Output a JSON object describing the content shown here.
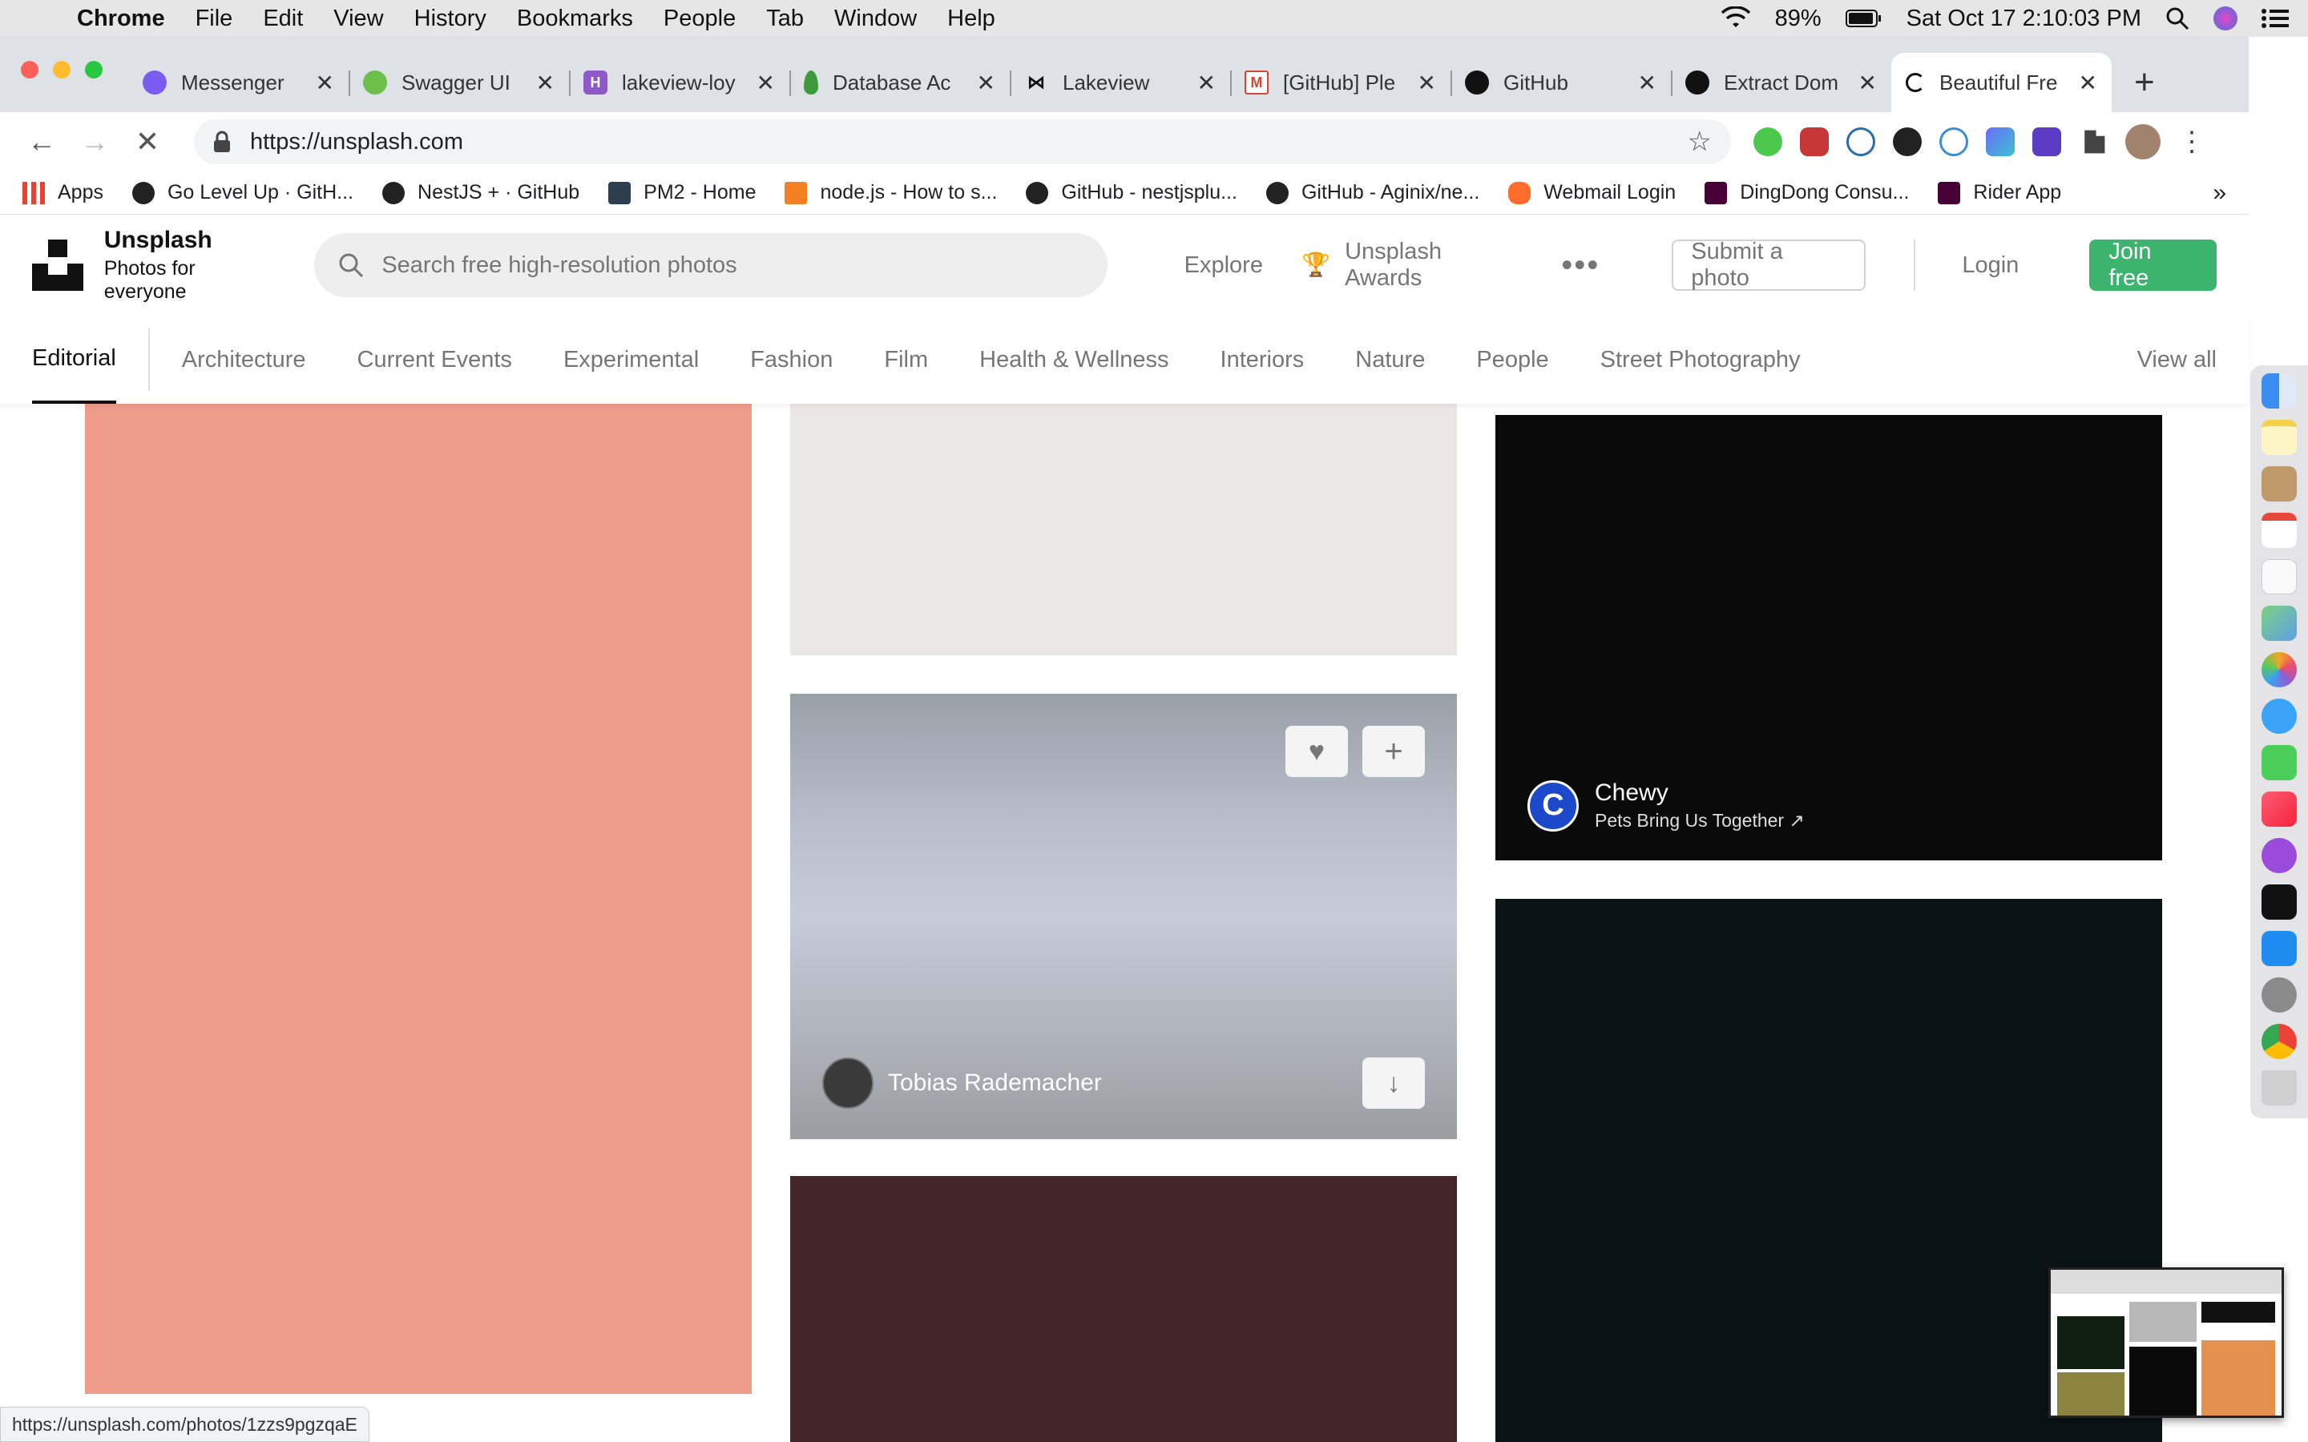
{
  "menubar": {
    "app": "Chrome",
    "items": [
      "File",
      "Edit",
      "View",
      "History",
      "Bookmarks",
      "People",
      "Tab",
      "Window",
      "Help"
    ],
    "battery": "89%",
    "clock": "Sat Oct 17  2:10:03 PM"
  },
  "tabs": [
    {
      "title": "Messenger",
      "color": "#7b5cf0"
    },
    {
      "title": "Swagger UI",
      "color": "#6cc04a"
    },
    {
      "title": "lakeview-loy",
      "color": "#8e58c7"
    },
    {
      "title": "Database Ac",
      "color": "#3d9a3d"
    },
    {
      "title": "Lakeview",
      "color": "#111111"
    },
    {
      "title": "[GitHub] Ple",
      "color": "#d44638"
    },
    {
      "title": "GitHub",
      "color": "#111111"
    },
    {
      "title": "Extract Dom",
      "color": "#111111"
    },
    {
      "title": "Beautiful Fre",
      "color": "#111111"
    }
  ],
  "address": {
    "url": "https://unsplash.com"
  },
  "bookmarks": [
    {
      "label": "Apps"
    },
    {
      "label": "Go Level Up · GitH..."
    },
    {
      "label": "NestJS + · GitHub"
    },
    {
      "label": "PM2 - Home"
    },
    {
      "label": "node.js - How to s..."
    },
    {
      "label": "GitHub - nestjsplu..."
    },
    {
      "label": "GitHub - Aginix/ne..."
    },
    {
      "label": "Webmail Login"
    },
    {
      "label": "DingDong Consu..."
    },
    {
      "label": "Rider App"
    }
  ],
  "header": {
    "brand_name": "Unsplash",
    "brand_tagline": "Photos for everyone",
    "search_placeholder": "Search free high-resolution photos",
    "explore": "Explore",
    "awards": "Unsplash Awards",
    "submit": "Submit a photo",
    "login": "Login",
    "join": "Join free"
  },
  "topics": {
    "active": "Editorial",
    "items": [
      "Architecture",
      "Current Events",
      "Experimental",
      "Fashion",
      "Film",
      "Health & Wellness",
      "Interiors",
      "Nature",
      "People",
      "Street Photography"
    ],
    "view_all": "View all"
  },
  "photos": {
    "author_name": "Tobias Rademacher",
    "sponsor_name": "Chewy",
    "sponsor_tagline": "Pets Bring Us Together ↗",
    "sponsor_initial": "C"
  },
  "status_url": "https://unsplash.com/photos/1zzs9pgzqaE",
  "colors": {
    "join_button": "#3cb46e",
    "salmon_photo": "#f09c8b",
    "maroon_photo": "#43252a"
  }
}
